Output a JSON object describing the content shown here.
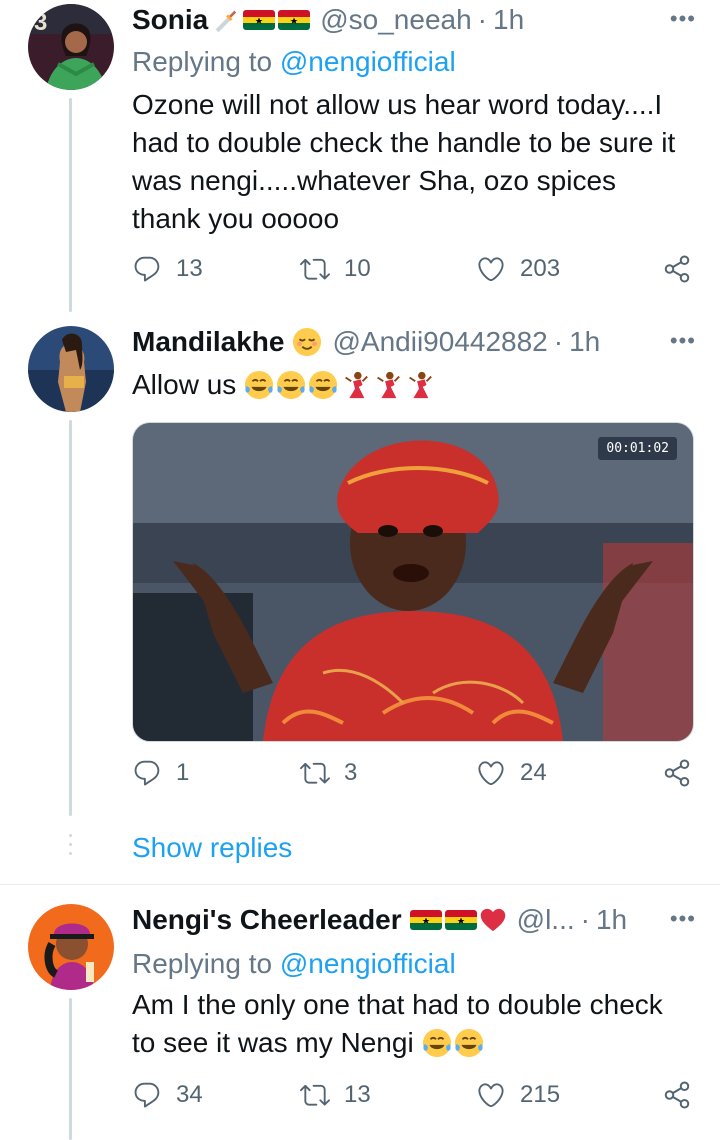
{
  "tweets": [
    {
      "name": "Sonia",
      "badges": [
        "dagger",
        "ghana-flag",
        "ghana-flag"
      ],
      "handle": "@so_neeah",
      "dot": "·",
      "time": "1h",
      "replying_label": "Replying to ",
      "replying_to": "@nengiofficial",
      "text_lines": [
        "Ozone will not allow us hear word today....I",
        "had to double check the handle to be sure it",
        "was nengi.....whatever Sha, ozo spices",
        "thank you ooooo"
      ],
      "replies": "13",
      "retweets": "10",
      "likes": "203"
    },
    {
      "name": "Mandilakhe",
      "badges": [
        "relieved-face"
      ],
      "handle": "@Andii90442882",
      "dot": "·",
      "time": "1h",
      "text": "Allow us",
      "text_emojis": [
        "tears-of-joy",
        "tears-of-joy",
        "tears-of-joy",
        "dancer",
        "dancer",
        "dancer"
      ],
      "media_timer": "00:01:02",
      "replies": "1",
      "retweets": "3",
      "likes": "24"
    },
    {
      "name": "Nengi's Cheerleader",
      "badges": [
        "ghana-flag",
        "ghana-flag",
        "red-heart"
      ],
      "handle": "@l...",
      "dot": "·",
      "time": "1h",
      "replying_label": "Replying to ",
      "replying_to": "@nengiofficial",
      "text_lines": [
        "Am I the only one that had to double check",
        "to see it was my Nengi"
      ],
      "text_emojis": [
        "tears-of-joy",
        "tears-of-joy"
      ],
      "replies": "34",
      "retweets": "13",
      "likes": "215"
    }
  ],
  "more_glyph": "•••",
  "show_replies": "Show replies",
  "colors": {
    "link": "#1da1f2",
    "muted": "#657786",
    "divider": "#e6ecf0"
  }
}
